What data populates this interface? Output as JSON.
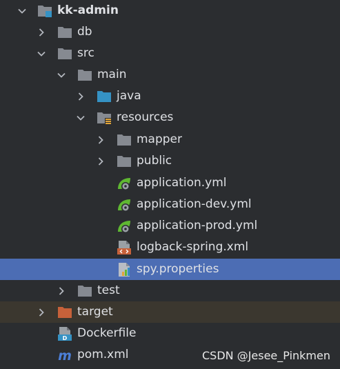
{
  "tree": {
    "root": {
      "label": "kk-admin"
    },
    "db": {
      "label": "db"
    },
    "src": {
      "label": "src"
    },
    "main": {
      "label": "main"
    },
    "java": {
      "label": "java"
    },
    "resources": {
      "label": "resources"
    },
    "mapper": {
      "label": "mapper"
    },
    "public": {
      "label": "public"
    },
    "application_yml": {
      "label": "application.yml"
    },
    "application_dev": {
      "label": "application-dev.yml"
    },
    "application_prod": {
      "label": "application-prod.yml"
    },
    "logback": {
      "label": "logback-spring.xml"
    },
    "spy": {
      "label": "spy.properties"
    },
    "test": {
      "label": "test"
    },
    "target": {
      "label": "target"
    },
    "dockerfile": {
      "label": "Dockerfile"
    },
    "pom": {
      "label": "pom.xml"
    }
  },
  "icons": {
    "folder": "folder-icon",
    "source_folder": "source-folder-icon",
    "resources_folder": "resources-folder-icon",
    "excluded_folder": "excluded-folder-icon",
    "spring_yaml": "spring-config-icon",
    "xml": "xml-file-icon",
    "properties": "properties-file-icon",
    "docker": "dockerfile-icon",
    "maven": "maven-icon"
  },
  "colors": {
    "background": "#2b2d30",
    "selection": "#4c6db4",
    "excluded_row": "#3b372f",
    "folder": "#868a91",
    "source_folder": "#3592c4",
    "excluded_folder": "#c7613a",
    "spring": "#5fb832",
    "maven": "#4c7fd8"
  },
  "watermark": "CSDN @Jesee_Pinkmen"
}
